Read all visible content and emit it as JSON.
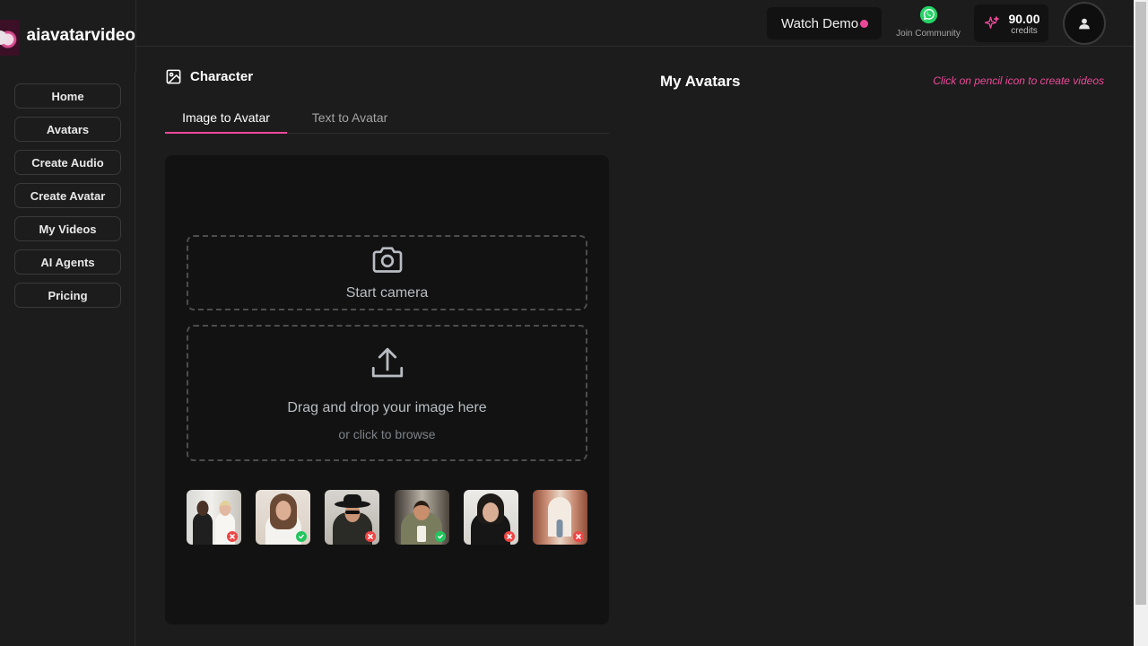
{
  "app": {
    "name": "aiavatarvideo"
  },
  "sidebar": {
    "items": [
      {
        "label": "Home"
      },
      {
        "label": "Avatars"
      },
      {
        "label": "Create Audio"
      },
      {
        "label": "Create Avatar"
      },
      {
        "label": "My Videos"
      },
      {
        "label": "AI Agents"
      },
      {
        "label": "Pricing"
      }
    ]
  },
  "header": {
    "watch_demo": "Watch Demo",
    "community": "Join Community",
    "credits_amount": "90.00",
    "credits_label": "credits"
  },
  "character": {
    "title": "Character",
    "tabs": [
      {
        "label": "Image to Avatar",
        "active": true
      },
      {
        "label": "Text to Avatar",
        "active": false
      }
    ],
    "camera_label": "Start camera",
    "drop_label": "Drag and drop your image here",
    "drop_sub": "or click to browse",
    "samples": [
      {
        "name": "couple photo",
        "status": "rejected"
      },
      {
        "name": "woman portrait",
        "status": "accepted"
      },
      {
        "name": "man with hat and sunglasses",
        "status": "rejected"
      },
      {
        "name": "man in suit",
        "status": "accepted"
      },
      {
        "name": "young man portrait",
        "status": "rejected"
      },
      {
        "name": "person in corridor",
        "status": "rejected"
      }
    ]
  },
  "my_avatars": {
    "title": "My Avatars",
    "hint": "Click on pencil icon to create videos"
  },
  "colors": {
    "accent": "#ec4899",
    "accept": "#22c55e",
    "reject": "#ef4444"
  }
}
